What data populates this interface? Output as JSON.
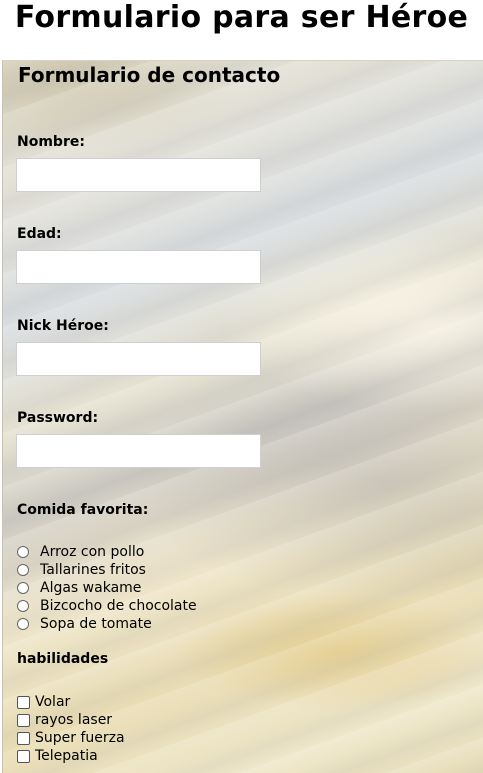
{
  "page": {
    "title": "Formulario para ser Héroe"
  },
  "form": {
    "legend": "Formulario de contacto",
    "fields": [
      {
        "label": "Nombre:",
        "value": ""
      },
      {
        "label": "Edad:",
        "value": ""
      },
      {
        "label": "Nick Héroe:",
        "value": ""
      },
      {
        "label": "Password:",
        "value": ""
      }
    ],
    "food": {
      "label": "Comida favorita:",
      "options": [
        "Arroz con pollo",
        "Tallarines fritos",
        "Algas wakame",
        "Bizcocho de chocolate",
        "Sopa de tomate"
      ]
    },
    "skills": {
      "label": "habilidades",
      "options": [
        "Volar",
        "rayos laser",
        "Super fuerza",
        "Telepatia"
      ]
    }
  }
}
